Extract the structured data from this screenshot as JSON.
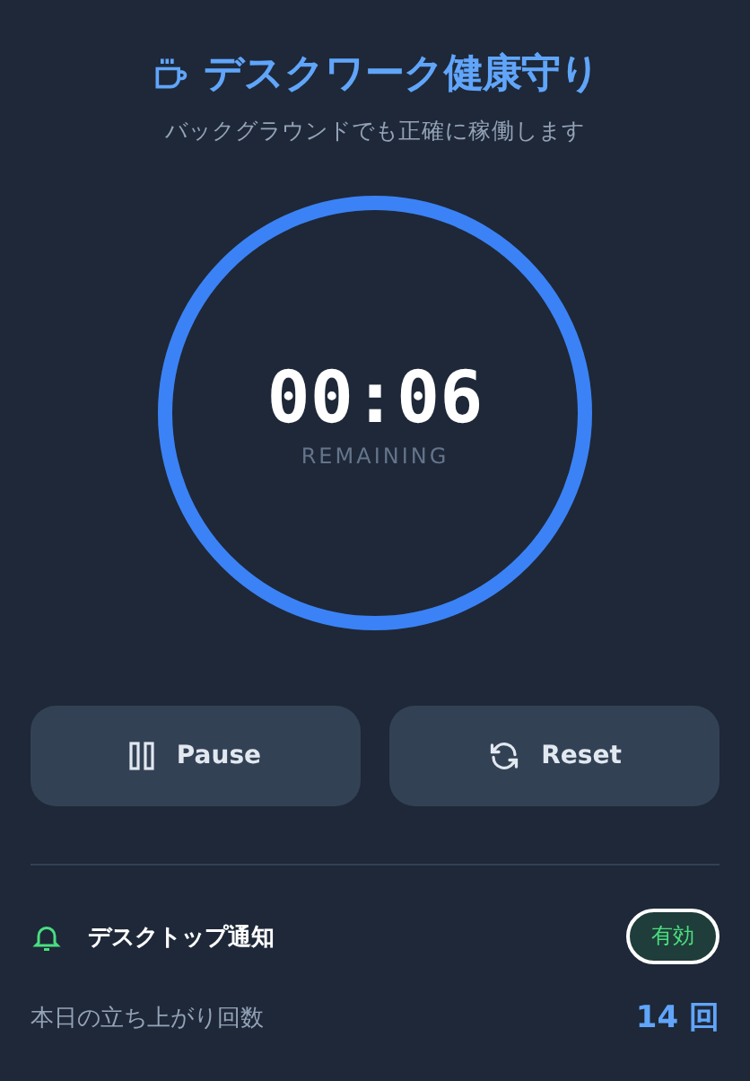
{
  "header": {
    "title": "デスクワーク健康守り",
    "subtitle": "バックグラウンドでも正確に稼働します"
  },
  "timer": {
    "time": "00:06",
    "label": "REMAINING",
    "level": 1
  },
  "buttons": [
    {
      "kind": "pause",
      "label": "Pause"
    },
    {
      "kind": "reset",
      "label": "Reset"
    }
  ],
  "notification": {
    "label": "デスクトップ通知",
    "status": "有効",
    "on": true
  },
  "stats": {
    "label": "本日の立ち上がり回数",
    "value": "14 回"
  }
}
